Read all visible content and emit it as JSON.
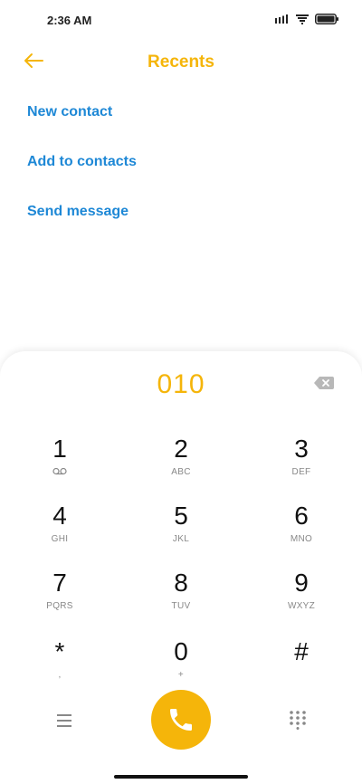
{
  "status": {
    "time": "2:36 AM"
  },
  "header": {
    "title": "Recents"
  },
  "actions": [
    {
      "label": "New contact"
    },
    {
      "label": "Add to contacts"
    },
    {
      "label": "Send message"
    }
  ],
  "dialer": {
    "number": "010",
    "keys": [
      {
        "digit": "1",
        "letters": ""
      },
      {
        "digit": "2",
        "letters": "ABC"
      },
      {
        "digit": "3",
        "letters": "DEF"
      },
      {
        "digit": "4",
        "letters": "GHI"
      },
      {
        "digit": "5",
        "letters": "JKL"
      },
      {
        "digit": "6",
        "letters": "MNO"
      },
      {
        "digit": "7",
        "letters": "PQRS"
      },
      {
        "digit": "8",
        "letters": "TUV"
      },
      {
        "digit": "9",
        "letters": "WXYZ"
      },
      {
        "digit": "*",
        "letters": ","
      },
      {
        "digit": "0",
        "letters": "+"
      },
      {
        "digit": "#",
        "letters": ""
      }
    ]
  },
  "colors": {
    "accent": "#f5b50a",
    "link": "#1e88d6"
  },
  "icons": [
    "back-arrow-icon",
    "signal-icon",
    "wifi-icon",
    "battery-icon",
    "backspace-icon",
    "voicemail-icon",
    "menu-icon",
    "phone-icon",
    "keypad-icon"
  ]
}
